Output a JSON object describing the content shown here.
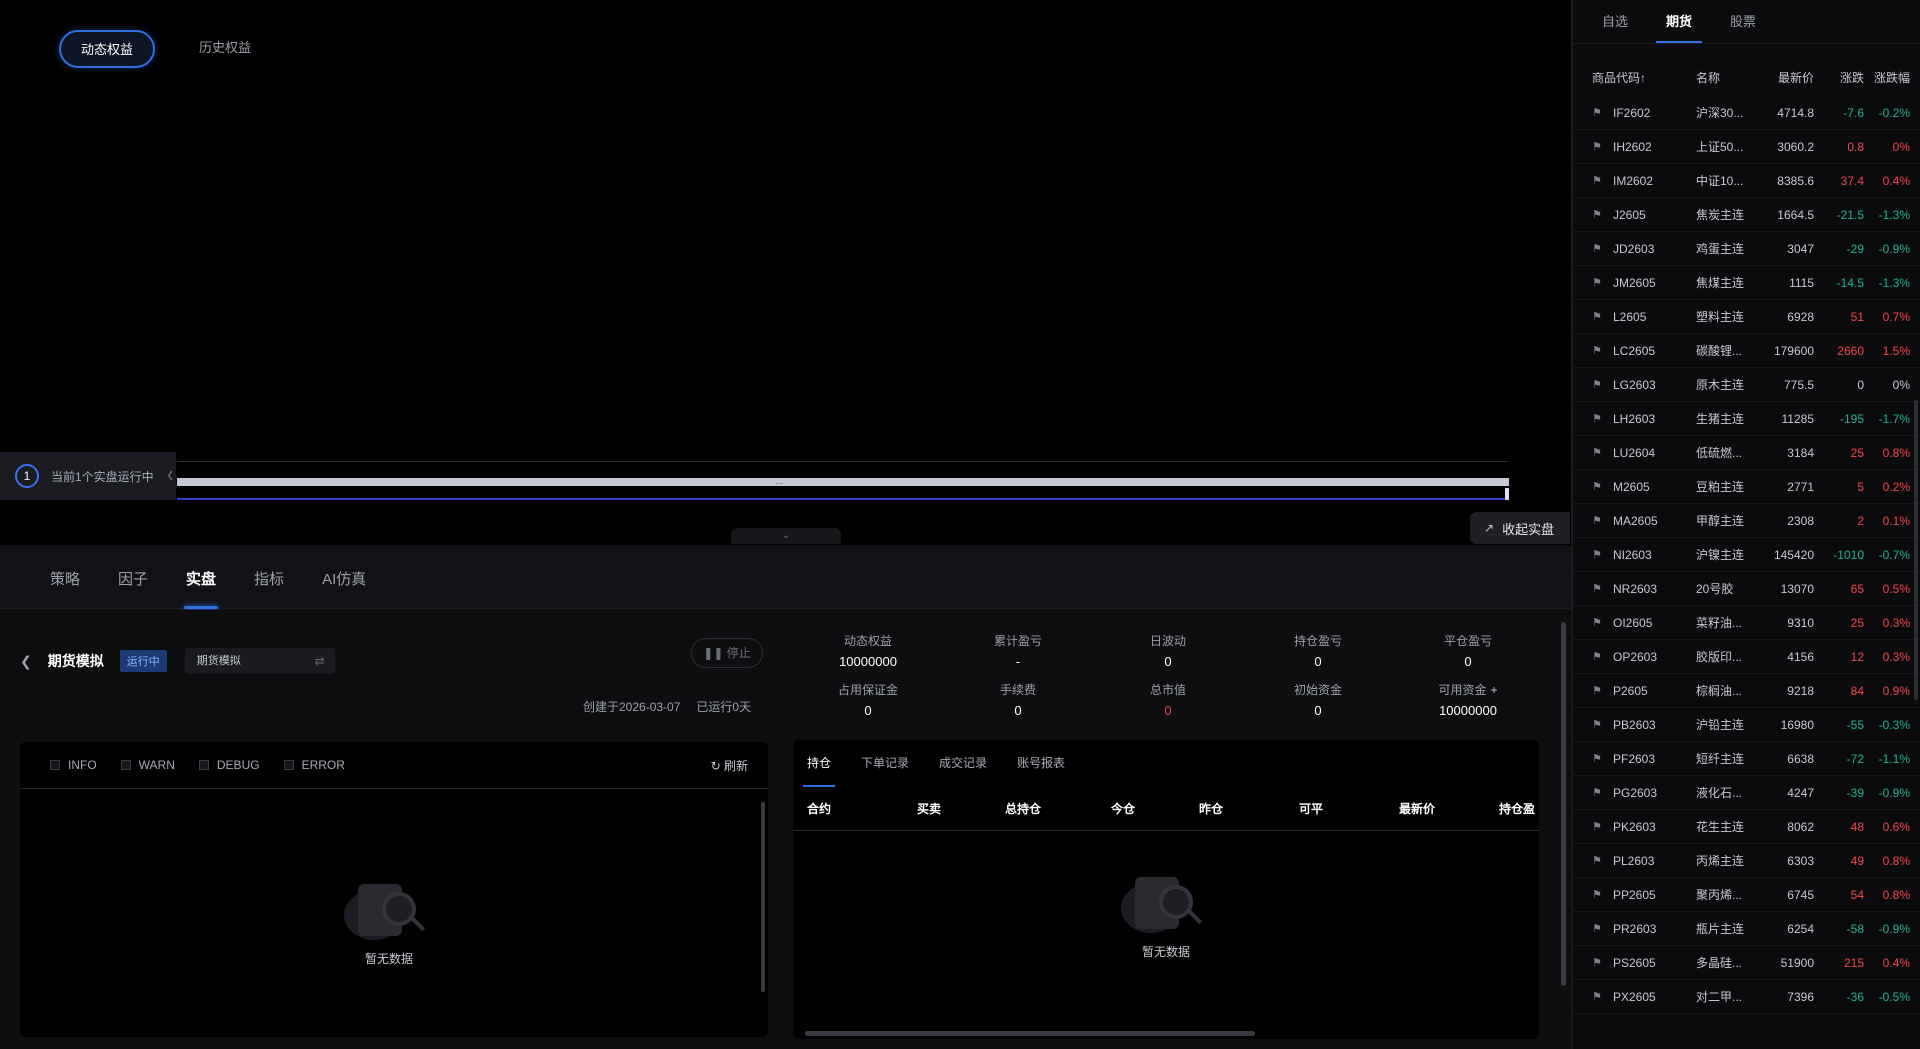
{
  "equity_tabs": [
    {
      "label": "动态权益",
      "active": true
    },
    {
      "label": "历史权益",
      "active": false
    }
  ],
  "running_indicator": {
    "count": "1",
    "text": "当前1个实盘运行中"
  },
  "slider": {
    "center_mark": "⋯"
  },
  "collapse_button": {
    "label": "收起实盘"
  },
  "main_tabs": [
    {
      "label": "策略",
      "active": false
    },
    {
      "label": "因子",
      "active": false
    },
    {
      "label": "实盘",
      "active": true
    },
    {
      "label": "指标",
      "active": false
    },
    {
      "label": "AI仿真",
      "active": false
    }
  ],
  "strategy": {
    "name": "期货模拟",
    "status": "运行中",
    "account": "期货模拟",
    "stop_label": "停止",
    "created": "创建于2026-03-07",
    "running_days": "已运行0天"
  },
  "stats": [
    {
      "label": "动态权益",
      "value": "10000000",
      "color": "normal"
    },
    {
      "label": "累计盈亏",
      "value": "-",
      "color": "normal"
    },
    {
      "label": "日波动",
      "value": "0",
      "color": "normal"
    },
    {
      "label": "持仓盈亏",
      "value": "0",
      "color": "normal"
    },
    {
      "label": "平仓盈亏",
      "value": "0",
      "color": "normal"
    },
    {
      "label": "占用保证金",
      "value": "0",
      "color": "normal"
    },
    {
      "label": "手续费",
      "value": "0",
      "color": "normal"
    },
    {
      "label": "总市值",
      "value": "0",
      "color": "red"
    },
    {
      "label": "初始资金",
      "value": "0",
      "color": "normal"
    },
    {
      "label": "可用资金",
      "value": "10000000",
      "color": "normal"
    }
  ],
  "log_panel": {
    "levels": [
      "INFO",
      "WARN",
      "DEBUG",
      "ERROR"
    ],
    "refresh_label": "刷新",
    "empty_text": "暂无数据"
  },
  "positions_panel": {
    "tabs": [
      {
        "label": "持仓",
        "active": true
      },
      {
        "label": "下单记录",
        "active": false
      },
      {
        "label": "成交记录",
        "active": false
      },
      {
        "label": "账号报表",
        "active": false
      }
    ],
    "columns": [
      "合约",
      "买卖",
      "总持仓",
      "今仓",
      "昨仓",
      "可平",
      "最新价",
      "持仓盈"
    ],
    "empty_text": "暂无数据"
  },
  "sidebar": {
    "tabs": [
      {
        "label": "自选",
        "active": false
      },
      {
        "label": "期货",
        "active": true
      },
      {
        "label": "股票",
        "active": false
      }
    ],
    "columns": {
      "code": "商品代码↑",
      "name": "名称",
      "last": "最新价",
      "change": "涨跌",
      "pct": "涨跌幅"
    },
    "rows": [
      {
        "code": "IF2602",
        "name": "沪深30...",
        "last": "4714.8",
        "change": "-7.6",
        "pct": "-0.2%",
        "dir": "down"
      },
      {
        "code": "IH2602",
        "name": "上证50...",
        "last": "3060.2",
        "change": "0.8",
        "pct": "0%",
        "dir": "up"
      },
      {
        "code": "IM2602",
        "name": "中证10...",
        "last": "8385.6",
        "change": "37.4",
        "pct": "0.4%",
        "dir": "up"
      },
      {
        "code": "J2605",
        "name": "焦炭主连",
        "last": "1664.5",
        "change": "-21.5",
        "pct": "-1.3%",
        "dir": "down"
      },
      {
        "code": "JD2603",
        "name": "鸡蛋主连",
        "last": "3047",
        "change": "-29",
        "pct": "-0.9%",
        "dir": "down"
      },
      {
        "code": "JM2605",
        "name": "焦煤主连",
        "last": "1115",
        "change": "-14.5",
        "pct": "-1.3%",
        "dir": "down"
      },
      {
        "code": "L2605",
        "name": "塑料主连",
        "last": "6928",
        "change": "51",
        "pct": "0.7%",
        "dir": "up"
      },
      {
        "code": "LC2605",
        "name": "碳酸锂...",
        "last": "179600",
        "change": "2660",
        "pct": "1.5%",
        "dir": "up"
      },
      {
        "code": "LG2603",
        "name": "原木主连",
        "last": "775.5",
        "change": "0",
        "pct": "0%",
        "dir": "flat"
      },
      {
        "code": "LH2603",
        "name": "生猪主连",
        "last": "11285",
        "change": "-195",
        "pct": "-1.7%",
        "dir": "down"
      },
      {
        "code": "LU2604",
        "name": "低硫燃...",
        "last": "3184",
        "change": "25",
        "pct": "0.8%",
        "dir": "up"
      },
      {
        "code": "M2605",
        "name": "豆粕主连",
        "last": "2771",
        "change": "5",
        "pct": "0.2%",
        "dir": "up"
      },
      {
        "code": "MA2605",
        "name": "甲醇主连",
        "last": "2308",
        "change": "2",
        "pct": "0.1%",
        "dir": "up"
      },
      {
        "code": "NI2603",
        "name": "沪镍主连",
        "last": "145420",
        "change": "-1010",
        "pct": "-0.7%",
        "dir": "down"
      },
      {
        "code": "NR2603",
        "name": "20号胶",
        "last": "13070",
        "change": "65",
        "pct": "0.5%",
        "dir": "up"
      },
      {
        "code": "OI2605",
        "name": "菜籽油...",
        "last": "9310",
        "change": "25",
        "pct": "0.3%",
        "dir": "up"
      },
      {
        "code": "OP2603",
        "name": "胶版印...",
        "last": "4156",
        "change": "12",
        "pct": "0.3%",
        "dir": "up"
      },
      {
        "code": "P2605",
        "name": "棕榈油...",
        "last": "9218",
        "change": "84",
        "pct": "0.9%",
        "dir": "up"
      },
      {
        "code": "PB2603",
        "name": "沪铅主连",
        "last": "16980",
        "change": "-55",
        "pct": "-0.3%",
        "dir": "down"
      },
      {
        "code": "PF2603",
        "name": "短纤主连",
        "last": "6638",
        "change": "-72",
        "pct": "-1.1%",
        "dir": "down"
      },
      {
        "code": "PG2603",
        "name": "液化石...",
        "last": "4247",
        "change": "-39",
        "pct": "-0.9%",
        "dir": "down"
      },
      {
        "code": "PK2603",
        "name": "花生主连",
        "last": "8062",
        "change": "48",
        "pct": "0.6%",
        "dir": "up"
      },
      {
        "code": "PL2603",
        "name": "丙烯主连",
        "last": "6303",
        "change": "49",
        "pct": "0.8%",
        "dir": "up"
      },
      {
        "code": "PP2605",
        "name": "聚丙烯...",
        "last": "6745",
        "change": "54",
        "pct": "0.8%",
        "dir": "up"
      },
      {
        "code": "PR2603",
        "name": "瓶片主连",
        "last": "6254",
        "change": "-58",
        "pct": "-0.9%",
        "dir": "down"
      },
      {
        "code": "PS2605",
        "name": "多晶硅...",
        "last": "51900",
        "change": "215",
        "pct": "0.4%",
        "dir": "up"
      },
      {
        "code": "PX2605",
        "name": "对二甲...",
        "last": "7396",
        "change": "-36",
        "pct": "-0.5%",
        "dir": "down"
      }
    ]
  }
}
